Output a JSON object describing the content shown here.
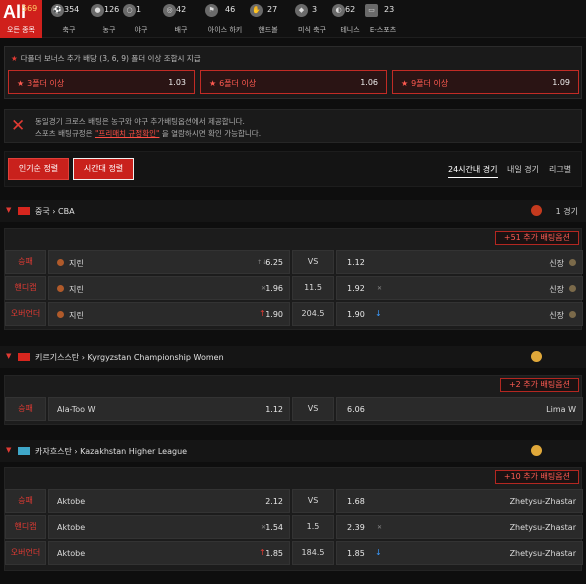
{
  "tabs": [
    {
      "label": "오든 종목",
      "count": "569",
      "icon": "all-icon",
      "big": "All"
    },
    {
      "label": "축구",
      "count": "354",
      "icon": "soccer-icon"
    },
    {
      "label": "농구",
      "count": "126",
      "icon": "basketball-icon"
    },
    {
      "label": "야구",
      "count": "1",
      "icon": "baseball-icon"
    },
    {
      "label": "배구",
      "count": "42",
      "icon": "volleyball-icon"
    },
    {
      "label": "아이스 하키",
      "count": "46",
      "icon": "hockey-icon"
    },
    {
      "label": "핸드볼",
      "count": "27",
      "icon": "handball-icon"
    },
    {
      "label": "미식 축구",
      "count": "3",
      "icon": "football-icon"
    },
    {
      "label": "테니스",
      "count": "62",
      "icon": "tennis-icon"
    },
    {
      "label": "E-스포츠",
      "count": "23",
      "icon": "esports-icon"
    }
  ],
  "bonus": {
    "heading": "다폴더 보너스 추가 배당 (3, 6, 9) 폴더 이상 조합시 지급",
    "items": [
      {
        "label": "3폴더 이상",
        "value": "1.03"
      },
      {
        "label": "6폴더 이상",
        "value": "1.06"
      },
      {
        "label": "9폴더 이상",
        "value": "1.09"
      }
    ]
  },
  "notice": {
    "line1": "동일경기 크로스 배팅은 농구와 야구 추가배팅옵션에서 제공합니다.",
    "line2_pre": "스포츠 배팅규정은 ",
    "line2_link": "\"프리매치 규정확인\"",
    "line2_post": " 을 열람하시면 확인 가능합니다."
  },
  "sort": {
    "popular": "인기순 정렬",
    "time": "시간대 정렬",
    "tab_24h": "24시간내 경기",
    "tab_tomorrow": "내일 경기",
    "tab_league": "리그별"
  },
  "leagues": [
    {
      "title": "중국 › CBA",
      "count": "1 경기",
      "more": "+51 추가 배팅옵션",
      "rows": [
        {
          "market": "승패",
          "home": "지린",
          "home_odd": "6.25",
          "mid": "VS",
          "away_odd": "1.12",
          "away": "신장"
        },
        {
          "market": "핸디캡",
          "home": "지린",
          "home_odd": "1.96",
          "mid": "11.5",
          "away_odd": "1.92",
          "away": "신장"
        },
        {
          "market": "오버언더",
          "home": "지린",
          "home_odd": "1.90",
          "mid": "204.5",
          "away_odd": "1.90",
          "away": "신장"
        }
      ]
    },
    {
      "title": "키르기스스탄 › Kyrgyzstan Championship Women",
      "count": "",
      "more": "+2 추가 배팅옵션",
      "rows": [
        {
          "market": "승패",
          "home": "Ala-Too W",
          "home_odd": "1.12",
          "mid": "VS",
          "away_odd": "6.06",
          "away": "Lima W"
        }
      ]
    },
    {
      "title": "카자흐스탄 › Kazakhstan Higher League",
      "count": "",
      "more": "+10 추가 배팅옵션",
      "rows": [
        {
          "market": "승패",
          "home": "Aktobe",
          "home_odd": "2.12",
          "mid": "VS",
          "away_odd": "1.68",
          "away": "Zhetysu-Zhastar"
        },
        {
          "market": "핸디캡",
          "home": "Aktobe",
          "home_odd": "1.54",
          "mid": "1.5",
          "away_odd": "2.39",
          "away": "Zhetysu-Zhastar"
        },
        {
          "market": "오버언더",
          "home": "Aktobe",
          "home_odd": "1.85",
          "mid": "184.5",
          "away_odd": "1.85",
          "away": "Zhetysu-Zhastar"
        }
      ]
    }
  ],
  "colors": {
    "accent": "#c9211c",
    "background": "#0e0e0e",
    "panel": "#1c1c1c"
  }
}
